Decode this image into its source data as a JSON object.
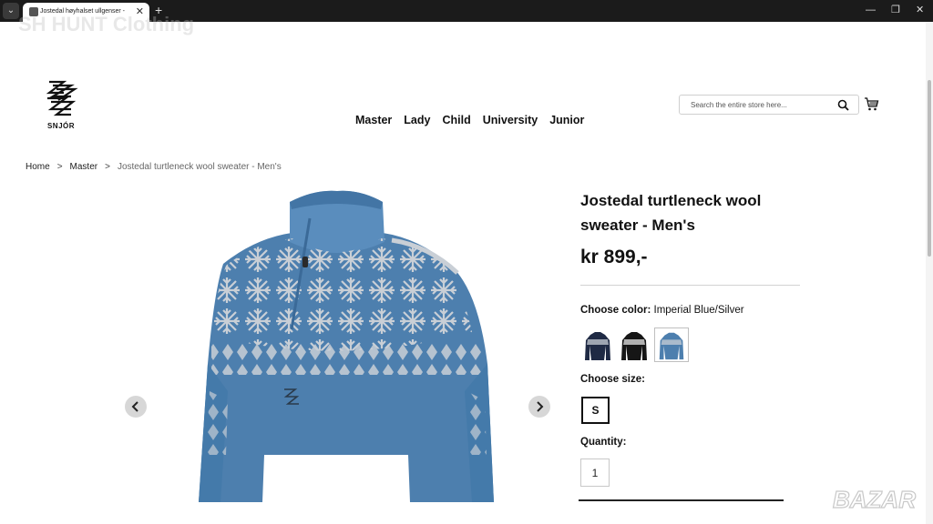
{
  "browser": {
    "tab_title": "Jostedal høyhalset ullgenser - ",
    "new_tab": "+",
    "close": "✕",
    "minimize": "—",
    "maximize": "❐",
    "close_window": "✕"
  },
  "watermark_top": "SH HUNT Clothing",
  "watermark_corner": "BAZAR",
  "brand": {
    "logo_text": "SNJÓR"
  },
  "nav": {
    "items": [
      "Master",
      "Lady",
      "Child",
      "University",
      "Junior"
    ]
  },
  "search": {
    "placeholder": "Search the entire store here..."
  },
  "breadcrumb": {
    "home": "Home",
    "category": "Master",
    "current": "Jostedal turtleneck wool sweater - Men's",
    "separator": ">"
  },
  "product": {
    "title": "Jostedal turtleneck wool sweater - Men's",
    "price": "kr 899,-",
    "color_label": "Choose color:",
    "color_value": "Imperial Blue/Silver",
    "swatches": [
      {
        "name": "navy",
        "color": "#1f2a44"
      },
      {
        "name": "black",
        "color": "#161616"
      },
      {
        "name": "imperial-blue",
        "color": "#4d7fae"
      }
    ],
    "size_label": "Choose size:",
    "size_value": "S",
    "quantity_label": "Quantity:",
    "quantity_value": "1"
  },
  "colors": {
    "accent": "#4d7fae",
    "pattern": "#c9cfd6",
    "text": "#111111"
  }
}
